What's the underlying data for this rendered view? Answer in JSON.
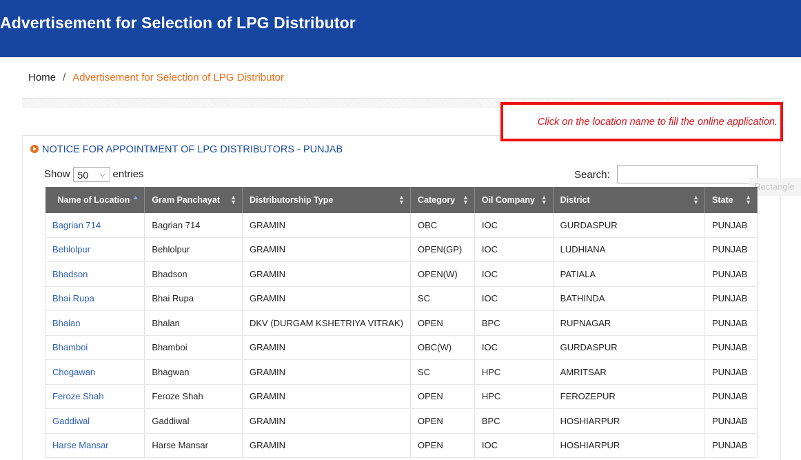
{
  "header": {
    "title": "Advertisement for Selection of LPG Distributor"
  },
  "breadcrumb": {
    "home": "Home",
    "separator": "/",
    "current": "Advertisement for Selection of LPG Distributor"
  },
  "notice": {
    "text": "Click on the location name to fill the online application."
  },
  "section": {
    "title": "NOTICE FOR APPOINTMENT OF LPG DISTRIBUTORS - PUNJAB"
  },
  "controls": {
    "show_label": "Show",
    "entries_value": "50",
    "entries_label": "entries",
    "search_label": "Search:",
    "search_value": ""
  },
  "overlay": {
    "label": "Rectangle"
  },
  "table": {
    "columns": [
      "Name of Location",
      "Gram Panchayat",
      "Distributorship Type",
      "Category",
      "Oil Company",
      "District",
      "State"
    ],
    "rows": [
      [
        "Bagrian 714",
        "Bagrian 714",
        "GRAMIN",
        "OBC",
        "IOC",
        "GURDASPUR",
        "PUNJAB"
      ],
      [
        "Behlolpur",
        "Behlolpur",
        "GRAMIN",
        "OPEN(GP)",
        "IOC",
        "LUDHIANA",
        "PUNJAB"
      ],
      [
        "Bhadson",
        "Bhadson",
        "GRAMIN",
        "OPEN(W)",
        "IOC",
        "PATIALA",
        "PUNJAB"
      ],
      [
        "Bhai Rupa",
        "Bhai Rupa",
        "GRAMIN",
        "SC",
        "IOC",
        "BATHINDA",
        "PUNJAB"
      ],
      [
        "Bhalan",
        "Bhalan",
        "DKV (DURGAM KSHETRIYA VITRAK)",
        "OPEN",
        "BPC",
        "RUPNAGAR",
        "PUNJAB"
      ],
      [
        "Bhamboi",
        "Bhamboi",
        "GRAMIN",
        "OBC(W)",
        "IOC",
        "GURDASPUR",
        "PUNJAB"
      ],
      [
        "Chogawan",
        "Bhagwan",
        "GRAMIN",
        "SC",
        "HPC",
        "AMRITSAR",
        "PUNJAB"
      ],
      [
        "Feroze Shah",
        "Feroze Shah",
        "GRAMIN",
        "OPEN",
        "HPC",
        "FEROZEPUR",
        "PUNJAB"
      ],
      [
        "Gaddiwal",
        "Gaddiwal",
        "GRAMIN",
        "OPEN",
        "BPC",
        "HOSHIARPUR",
        "PUNJAB"
      ],
      [
        "Harse Mansar",
        "Harse Mansar",
        "GRAMIN",
        "OPEN",
        "IOC",
        "HOSHIARPUR",
        "PUNJAB"
      ]
    ]
  }
}
